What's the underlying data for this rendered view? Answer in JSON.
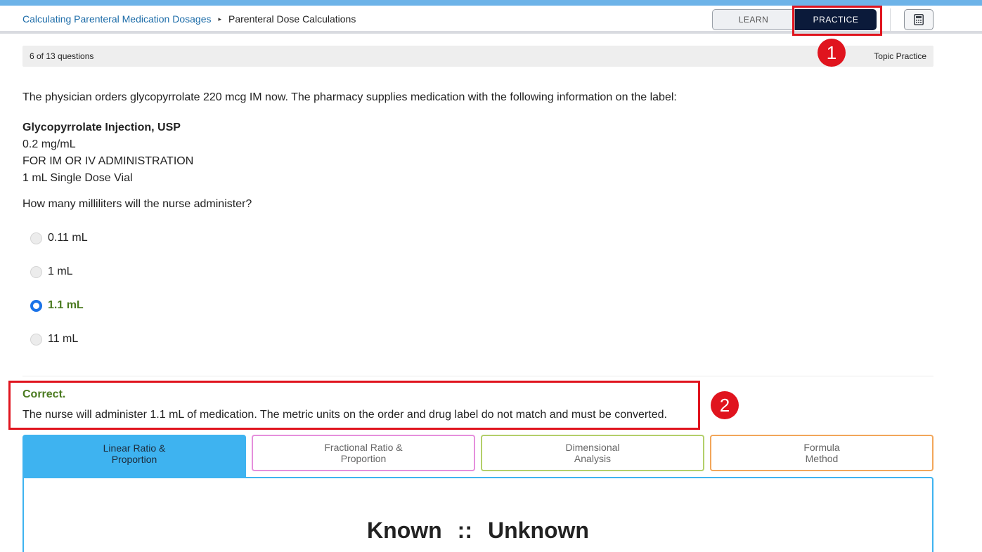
{
  "header": {
    "breadcrumb": {
      "parent": "Calculating Parenteral Medication Dosages",
      "separator": "▸",
      "current": "Parenteral Dose Calculations"
    },
    "learn_label": "LEARN",
    "practice_label": "PRACTICE",
    "calculator_icon": "calculator-icon"
  },
  "progress": {
    "count": "6 of 13 questions",
    "mode": "Topic Practice"
  },
  "annotations": {
    "badge1": "1",
    "badge2": "2"
  },
  "question": {
    "prompt": "The physician orders glycopyrrolate 220 mcg IM now. The pharmacy supplies medication with the following information on the label:",
    "label_lines": {
      "title": "Glycopyrrolate Injection, USP",
      "line1": "0.2 mg/mL",
      "line2": "FOR IM OR IV ADMINISTRATION",
      "line3": "1 mL Single Dose Vial"
    },
    "ask": "How many milliliters will the nurse administer?",
    "options": [
      {
        "label": "0.11 mL",
        "selected": false
      },
      {
        "label": "1 mL",
        "selected": false
      },
      {
        "label": "1.1 mL",
        "selected": true
      },
      {
        "label": "11 mL",
        "selected": false
      }
    ]
  },
  "feedback": {
    "title": "Correct.",
    "text": "The nurse will administer 1.1 mL of medication. The metric units on the order and drug label do not match and must be converted."
  },
  "method_tabs": [
    {
      "label": "Linear Ratio &\nProportion",
      "active": true
    },
    {
      "label": "Fractional Ratio &\nProportion",
      "active": false
    },
    {
      "label": "Dimensional\nAnalysis",
      "active": false
    },
    {
      "label": "Formula\nMethod",
      "active": false
    }
  ],
  "panel": {
    "known": "Known",
    "separator": "::",
    "unknown": "Unknown"
  },
  "colors": {
    "accent": "#3eb3f0",
    "practice_bg": "#0b1a3a",
    "correct": "#4a7a1f",
    "highlight": "#e0141e"
  }
}
